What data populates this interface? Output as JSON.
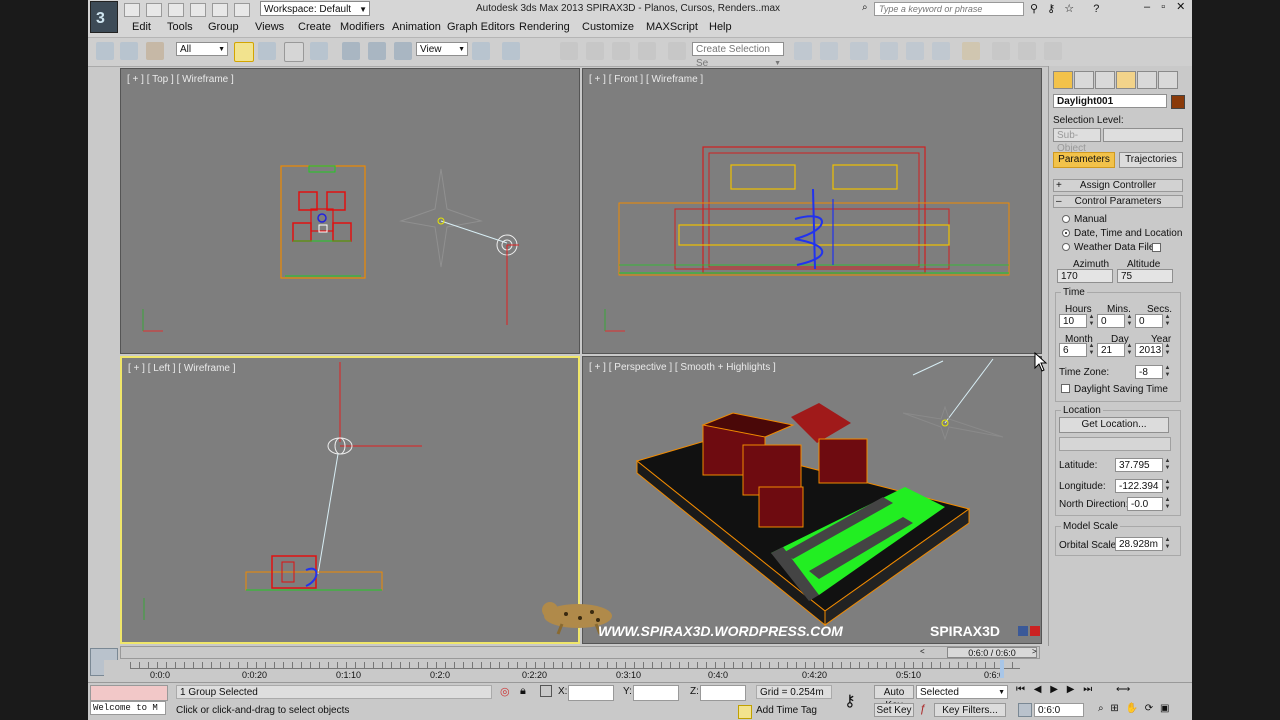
{
  "window": {
    "title": "Autodesk 3ds Max  2013    SPIRAX3D - Planos, Cursos, Renders..max",
    "workspace": "Workspace: Default",
    "search_placeholder": "Type a keyword or phrase"
  },
  "menu": [
    "Edit",
    "Tools",
    "Group",
    "Views",
    "Create",
    "Modifiers",
    "Animation",
    "Graph Editors",
    "Rendering",
    "Customize",
    "MAXScript",
    "Help"
  ],
  "toolbar": {
    "filter_value": "All",
    "refcoord_value": "View",
    "selection_set_placeholder": "Create Selection Se"
  },
  "viewports": {
    "top": "[ + ] [ Top ] [ Wireframe ]",
    "front": "[ + ] [ Front ] [ Wireframe ]",
    "left": "[ + ] [ Left ] [ Wireframe ]",
    "perspective": "[ + ] [ Perspective ] [ Smooth + Highlights ]"
  },
  "watermark": {
    "url": "WWW.SPIRAX3D.WORDPRESS.COM",
    "brand": "SPIRAX3D"
  },
  "command_panel": {
    "object_name": "Daylight001",
    "object_color": "#8a3a0a",
    "selection_level_label": "Selection Level:",
    "sub_object": "Sub-Object",
    "tab_parameters": "Parameters",
    "tab_trajectories": "Trajectories",
    "assign_controller": "Assign Controller",
    "control_parameters": "Control Parameters",
    "mode_manual": "Manual",
    "mode_date": "Date, Time and Location",
    "mode_weather": "Weather Data File",
    "azimuth_label": "Azimuth",
    "altitude_label": "Altitude",
    "azimuth": "170",
    "altitude": "75",
    "time_group": "Time",
    "hours_label": "Hours",
    "mins_label": "Mins.",
    "secs_label": "Secs.",
    "hours": "10",
    "mins": "0",
    "secs": "0",
    "month_label": "Month",
    "day_label": "Day",
    "year_label": "Year",
    "month": "6",
    "day": "21",
    "year": "2013",
    "time_zone_label": "Time Zone:",
    "time_zone": "-8",
    "daylight_saving": "Daylight Saving Time",
    "location_group": "Location",
    "get_location": "Get Location...",
    "latitude_label": "Latitude:",
    "latitude": "37.795",
    "longitude_label": "Longitude:",
    "longitude": "-122.394",
    "north_label": "North Direction:",
    "north": "-0.0",
    "model_scale_group": "Model Scale",
    "orbital_label": "Orbital Scale:",
    "orbital": "28.928m"
  },
  "timeline": {
    "slider": "0:6:0 / 0:6:0",
    "ticks": [
      "0:0:0",
      "0:0:20",
      "0:1:10",
      "0:2:0",
      "0:2:20",
      "0:3:10",
      "0:4:0",
      "0:4:20",
      "0:5:10",
      "0:6:0"
    ]
  },
  "status": {
    "maxscript": "Welcome to M",
    "selection": "1 Group Selected",
    "prompt": "Click or click-and-drag to select objects",
    "x_label": "X:",
    "y_label": "Y:",
    "z_label": "Z:",
    "grid": "Grid = 0.254m",
    "add_time_tag": "Add Time Tag",
    "auto_key": "Auto Key",
    "set_key": "Set Key",
    "key_mode": "Selected",
    "key_filters": "Key Filters...",
    "frame": "0:6:0"
  }
}
